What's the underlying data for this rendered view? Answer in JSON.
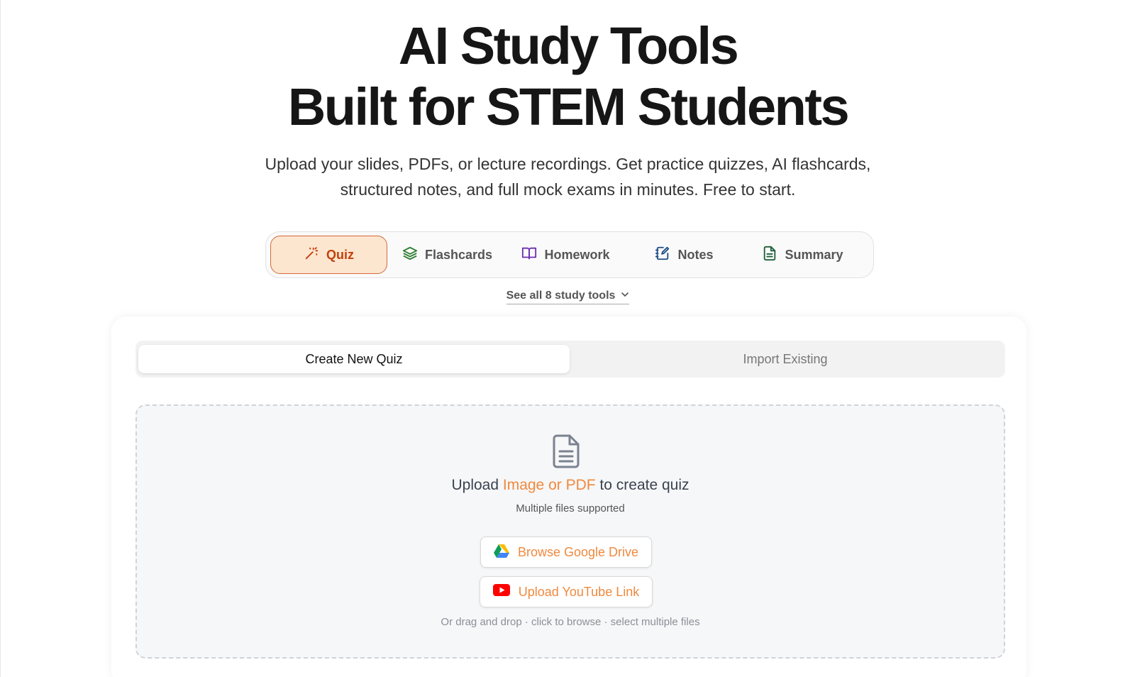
{
  "hero": {
    "title_line1": "AI Study Tools",
    "title_line2": "Built for STEM Students",
    "subtitle_line1": "Upload your slides, PDFs, or lecture recordings. Get practice quizzes, AI flashcards,",
    "subtitle_line2": "structured notes, and full mock exams in minutes. Free to start."
  },
  "tools": {
    "items": [
      {
        "label": "Quiz",
        "icon": "magic-wand-icon",
        "color": "#c2410c",
        "active": true
      },
      {
        "label": "Flashcards",
        "icon": "layers-icon",
        "color": "#2e7d32",
        "active": false
      },
      {
        "label": "Homework",
        "icon": "book-open-icon",
        "color": "#6b2fb3",
        "active": false
      },
      {
        "label": "Notes",
        "icon": "notebook-pen-icon",
        "color": "#1d4e89",
        "active": false
      },
      {
        "label": "Summary",
        "icon": "file-text-icon",
        "color": "#1f5e3a",
        "active": false
      }
    ],
    "see_all": "See all 8 study tools"
  },
  "mode": {
    "create": "Create New Quiz",
    "import": "Import Existing",
    "active": "create"
  },
  "upload": {
    "prefix": "Upload ",
    "accent": "Image or PDF",
    "suffix": " to create quiz",
    "multi_note": "Multiple files supported",
    "drive_button": "Browse Google Drive",
    "youtube_button": "Upload YouTube Link",
    "drag_note": "Or drag and drop · click to browse · select multiple files"
  },
  "colors": {
    "accent_orange": "#f0893e",
    "active_tab_bg": "#fde6d0",
    "active_tab_border": "#d2693a"
  }
}
